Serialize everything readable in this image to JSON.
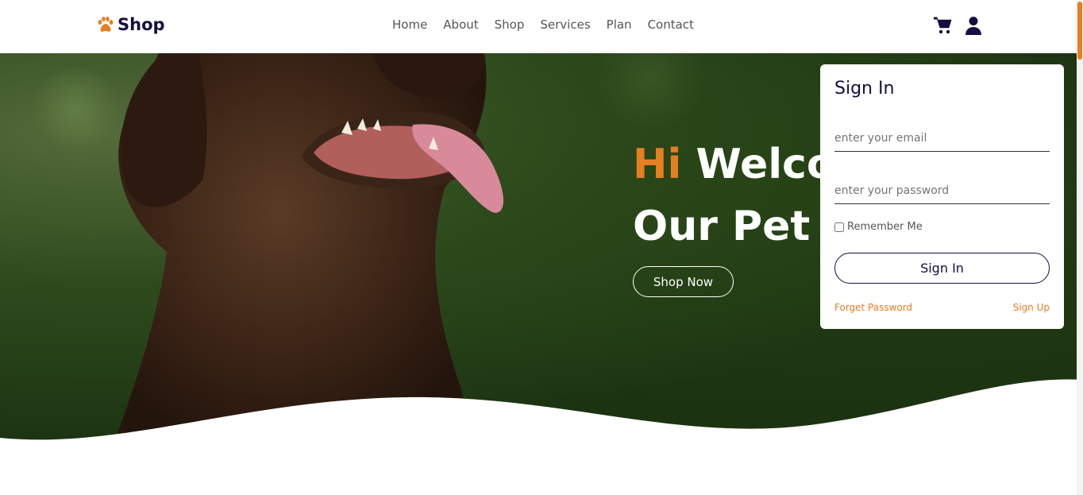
{
  "header": {
    "brand": "Shop",
    "nav": [
      "Home",
      "About",
      "Shop",
      "Services",
      "Plan",
      "Contact"
    ],
    "icons": [
      "cart-icon",
      "user-icon"
    ]
  },
  "hero": {
    "greeting": "Hi",
    "title_line1_rest": "Welcome To",
    "title_line2": "Our Pet Shop",
    "cta": "Shop Now"
  },
  "signin": {
    "title": "Sign In",
    "email_placeholder": "enter your email",
    "password_placeholder": "enter your password",
    "remember_label": "Remember Me",
    "submit_label": "Sign In",
    "forgot_label": "Forget Password",
    "signup_label": "Sign Up"
  },
  "colors": {
    "accent": "#e67e22",
    "brand_dark": "#130f40"
  }
}
